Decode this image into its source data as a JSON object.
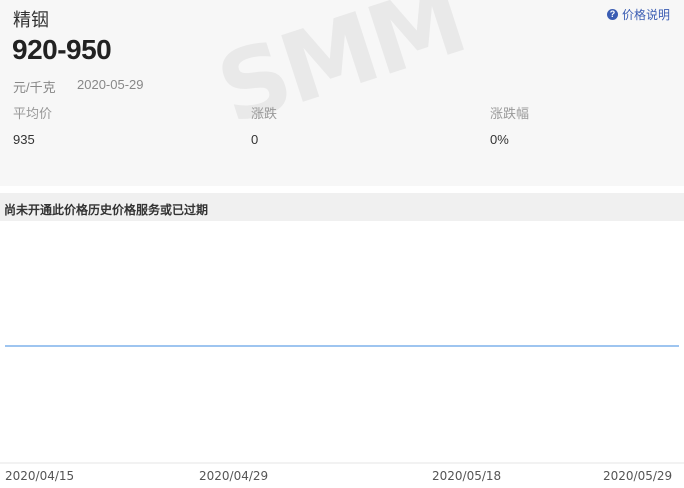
{
  "header": {
    "product_name": "精铟",
    "price_range": "920-950",
    "unit": "元/千克",
    "date": "2020-05-29",
    "price_note_label": "价格说明",
    "price_note_icon": "help-icon"
  },
  "stats": {
    "avg_label": "平均价",
    "avg_value": "935",
    "change_label": "涨跌",
    "change_value": "0",
    "change_pct_label": "涨跌幅",
    "change_pct_value": "0%"
  },
  "watermark": "SMM",
  "notice": {
    "text": "尚未开通此价格历史价格服务或已过期"
  },
  "colors": {
    "line": "#7fb2ec",
    "accent": "#3b5db3"
  },
  "chart_data": {
    "type": "line",
    "x": [
      "2020/04/15",
      "2020/04/29",
      "2020/05/18",
      "2020/05/29"
    ],
    "series": [
      {
        "values": [
          935,
          935,
          935,
          935
        ]
      }
    ],
    "xlabel": "",
    "ylabel": "",
    "grid": false
  }
}
